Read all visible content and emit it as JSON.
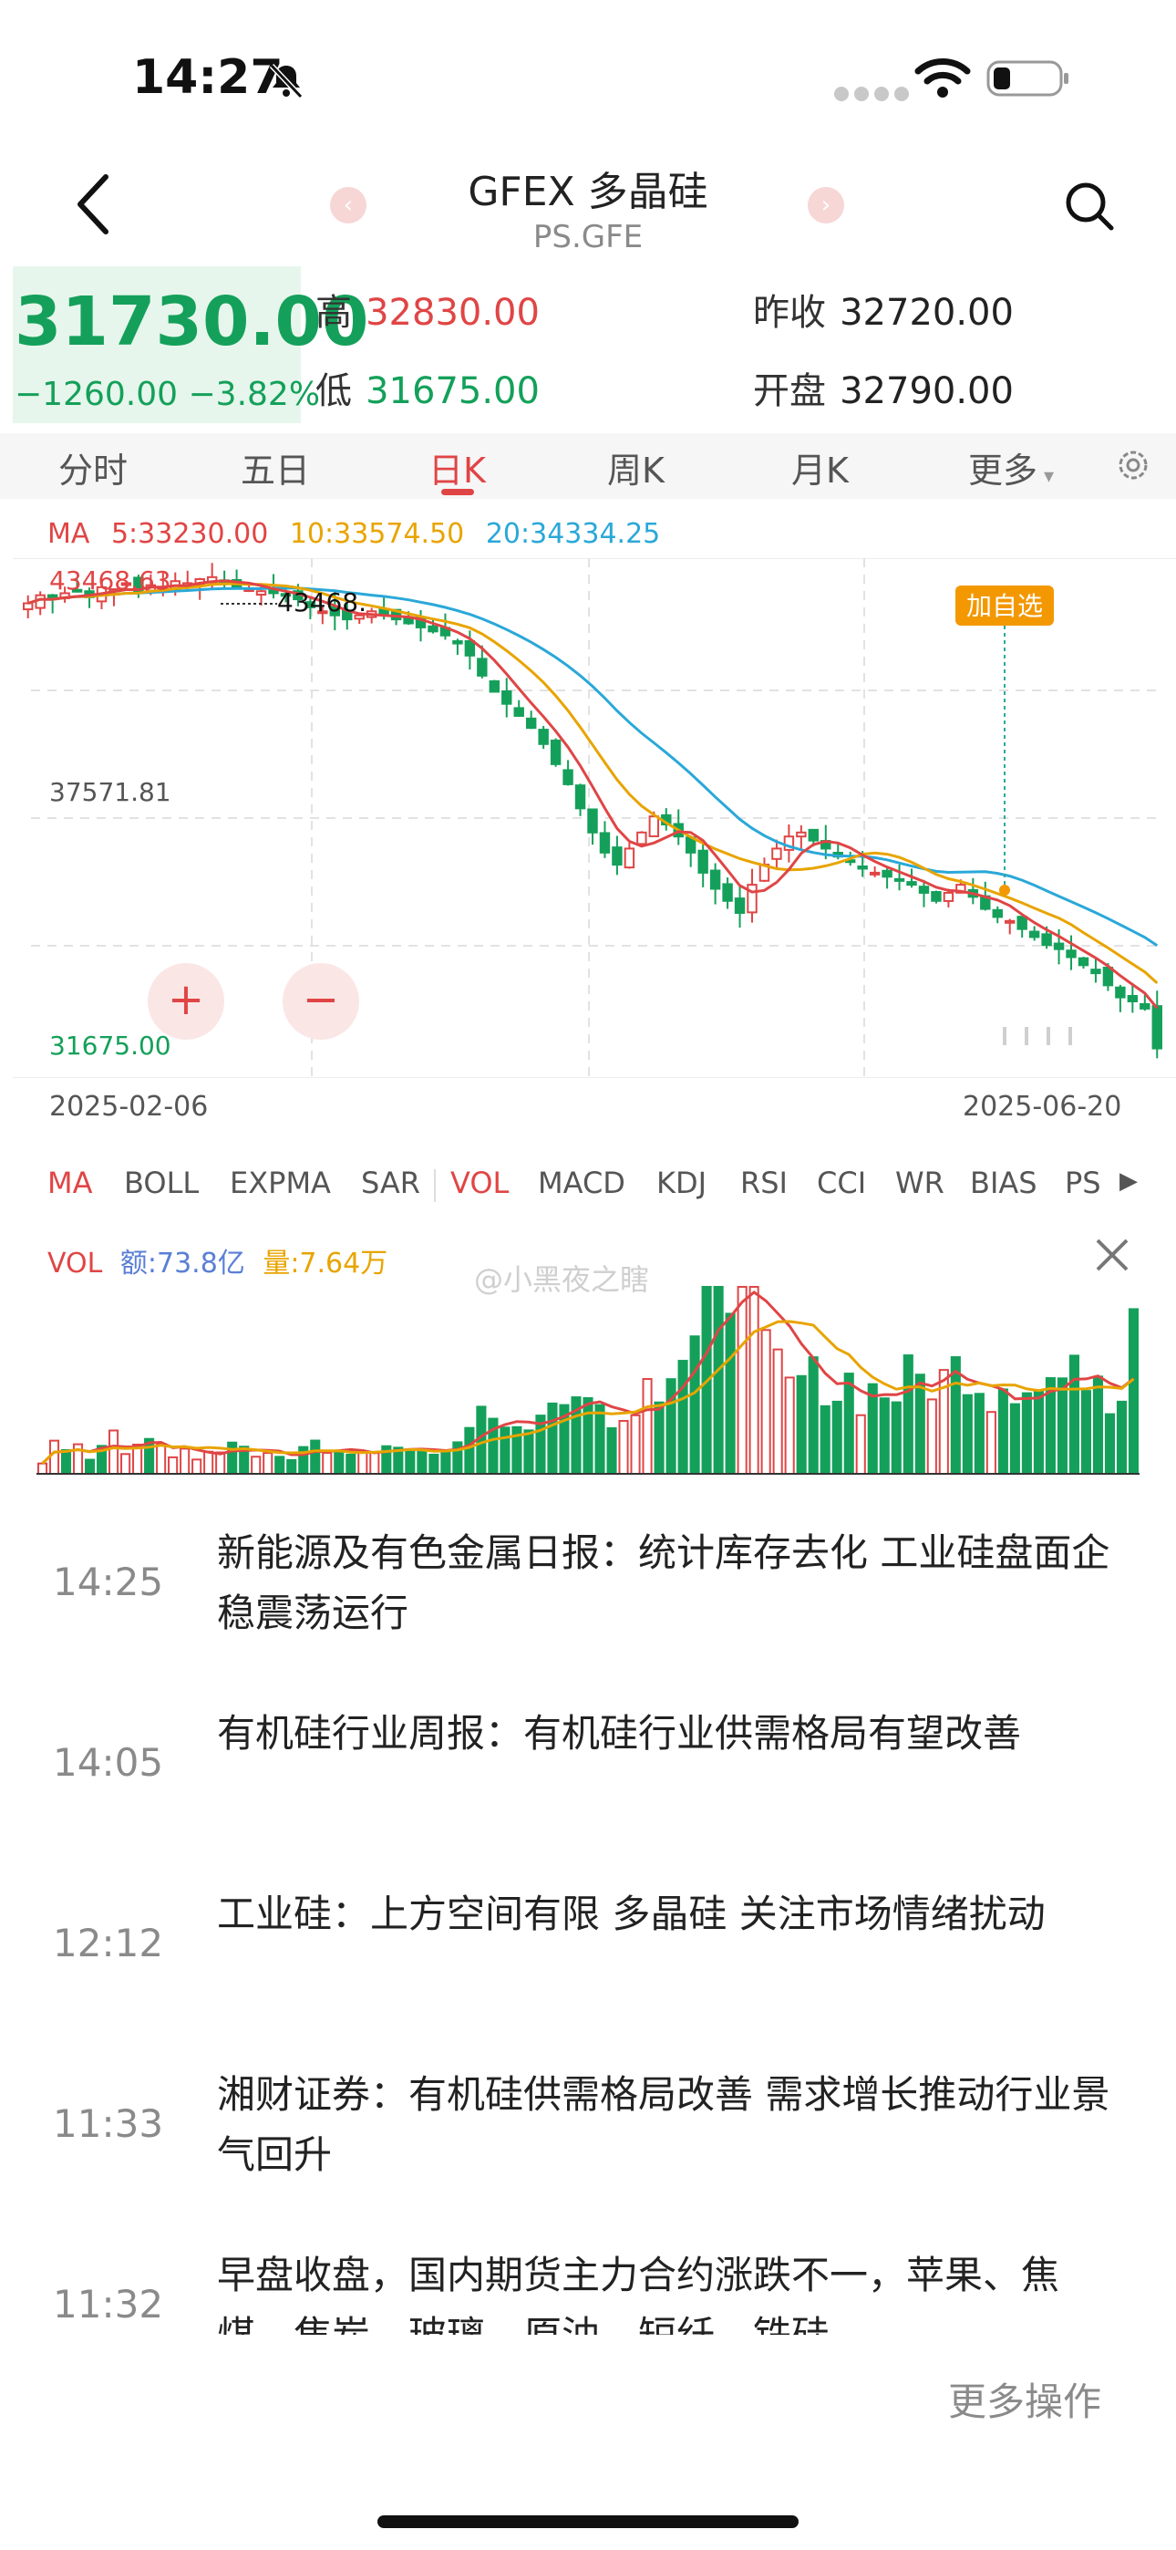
{
  "status": {
    "time": "14:27"
  },
  "header": {
    "title": "GFEX 多晶硅",
    "code": "PS.GFE"
  },
  "quote": {
    "price": "31730.00",
    "change": "−1260.00",
    "change_pct": "−3.82%",
    "high_label": "高",
    "high": "32830.00",
    "low_label": "低",
    "low": "31675.00",
    "prev_close_label": "昨收",
    "prev_close": "32720.00",
    "open_label": "开盘",
    "open": "32790.00"
  },
  "period_tabs": [
    "分时",
    "五日",
    "日K",
    "周K",
    "月K",
    "更多"
  ],
  "active_period": "日K",
  "ma_legend": {
    "label": "MA",
    "ma5": "5:33230.00",
    "ma10": "10:33574.50",
    "ma20": "20:34334.25"
  },
  "chart_labels": {
    "high": "43468.63",
    "high_marker": "43468.",
    "mid": "37571.81",
    "low": "31675.00",
    "date_start": "2025-02-06",
    "date_end": "2025-06-20",
    "add_watch": "加自选"
  },
  "indicator_tabs": [
    "MA",
    "BOLL",
    "EXPMA",
    "SAR",
    "VOL",
    "MACD",
    "KDJ",
    "RSI",
    "CCI",
    "WR",
    "BIAS",
    "PS"
  ],
  "vol_legend": {
    "label": "VOL",
    "amount": "额:73.8亿",
    "volume": "量:7.64万"
  },
  "watermark": "@小黑夜之瞎",
  "news": [
    {
      "time": "14:25",
      "title": "新能源及有色金属日报：统计库存去化 工业硅盘面企稳震荡运行"
    },
    {
      "time": "14:05",
      "title": "有机硅行业周报：有机硅行业供需格局有望改善"
    },
    {
      "time": "12:12",
      "title": "工业硅：上方空间有限 多晶硅 关注市场情绪扰动"
    },
    {
      "time": "11:33",
      "title": "湘财证券：有机硅供需格局改善 需求增长推动行业景气回升"
    },
    {
      "time": "11:32",
      "title": "早盘收盘，国内期货主力合约涨跌不一，苹果、焦煤、焦炭、玻璃、原油、短纤、铁硅"
    }
  ],
  "more_ops": "更多操作",
  "colors": {
    "up": "#e04545",
    "down": "#14a05a",
    "ma5": "#e04545",
    "ma10": "#e8a400",
    "ma20": "#2aa8d8",
    "accent": "#f39800"
  },
  "chart_data": {
    "type": "candlestick",
    "x_start": "2025-02-06",
    "x_end": "2025-06-20",
    "ylim": [
      31675.0,
      43468.63
    ],
    "close_approx": [
      42800,
      43000,
      42900,
      43050,
      43100,
      42950,
      43200,
      43150,
      43300,
      43100,
      43250,
      43200,
      43350,
      43300,
      43400,
      43450,
      43300,
      43200,
      43150,
      43100,
      43050,
      43000,
      42900,
      42700,
      42600,
      42500,
      42400,
      42500,
      42600,
      42500,
      42400,
      42300,
      42200,
      42100,
      42000,
      41800,
      41500,
      41000,
      40600,
      40300,
      40000,
      39700,
      39300,
      38800,
      38300,
      37700,
      37100,
      36600,
      36300,
      36700,
      37100,
      37500,
      37300,
      37000,
      36600,
      36100,
      35700,
      35400,
      35100,
      35800,
      36300,
      36700,
      37000,
      37100,
      36900,
      36700,
      36500,
      36400,
      36200,
      36100,
      36000,
      35900,
      35800,
      35600,
      35400,
      35600,
      35800,
      35500,
      35200,
      35000,
      34900,
      34700,
      34500,
      34300,
      34200,
      34000,
      33800,
      33600,
      33300,
      33000,
      32900,
      32720,
      31730
    ],
    "ma5_last": 33230.0,
    "ma10_last": 33574.5,
    "ma20_last": 34334.25
  }
}
